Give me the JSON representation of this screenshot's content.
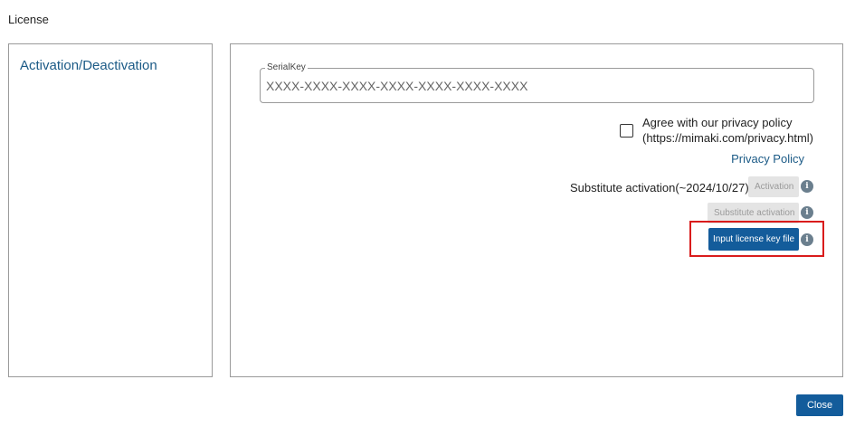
{
  "window": {
    "title": "License"
  },
  "sidebar": {
    "items": [
      {
        "label": "Activation/Deactivation"
      }
    ]
  },
  "serial": {
    "label": "SerialKey",
    "placeholder": "XXXX-XXXX-XXXX-XXXX-XXXX-XXXX-XXXX",
    "value": ""
  },
  "privacy": {
    "agree_line1": "Agree with our privacy policy",
    "agree_line2": "(https://mimaki.com/privacy.html)",
    "checked": false,
    "link_label": "Privacy Policy"
  },
  "activation": {
    "substitute_label": "Substitute activation(~2024/10/27)",
    "activation_button": "Activation",
    "substitute_button": "Substitute activation",
    "input_license_button": "Input license key file"
  },
  "footer": {
    "close_button": "Close"
  },
  "icons": {
    "info": "info-icon"
  },
  "colors": {
    "accent": "#135c9b",
    "link": "#1b5a86",
    "highlight": "#d91c1c",
    "disabled_bg": "#e4e4e4"
  }
}
